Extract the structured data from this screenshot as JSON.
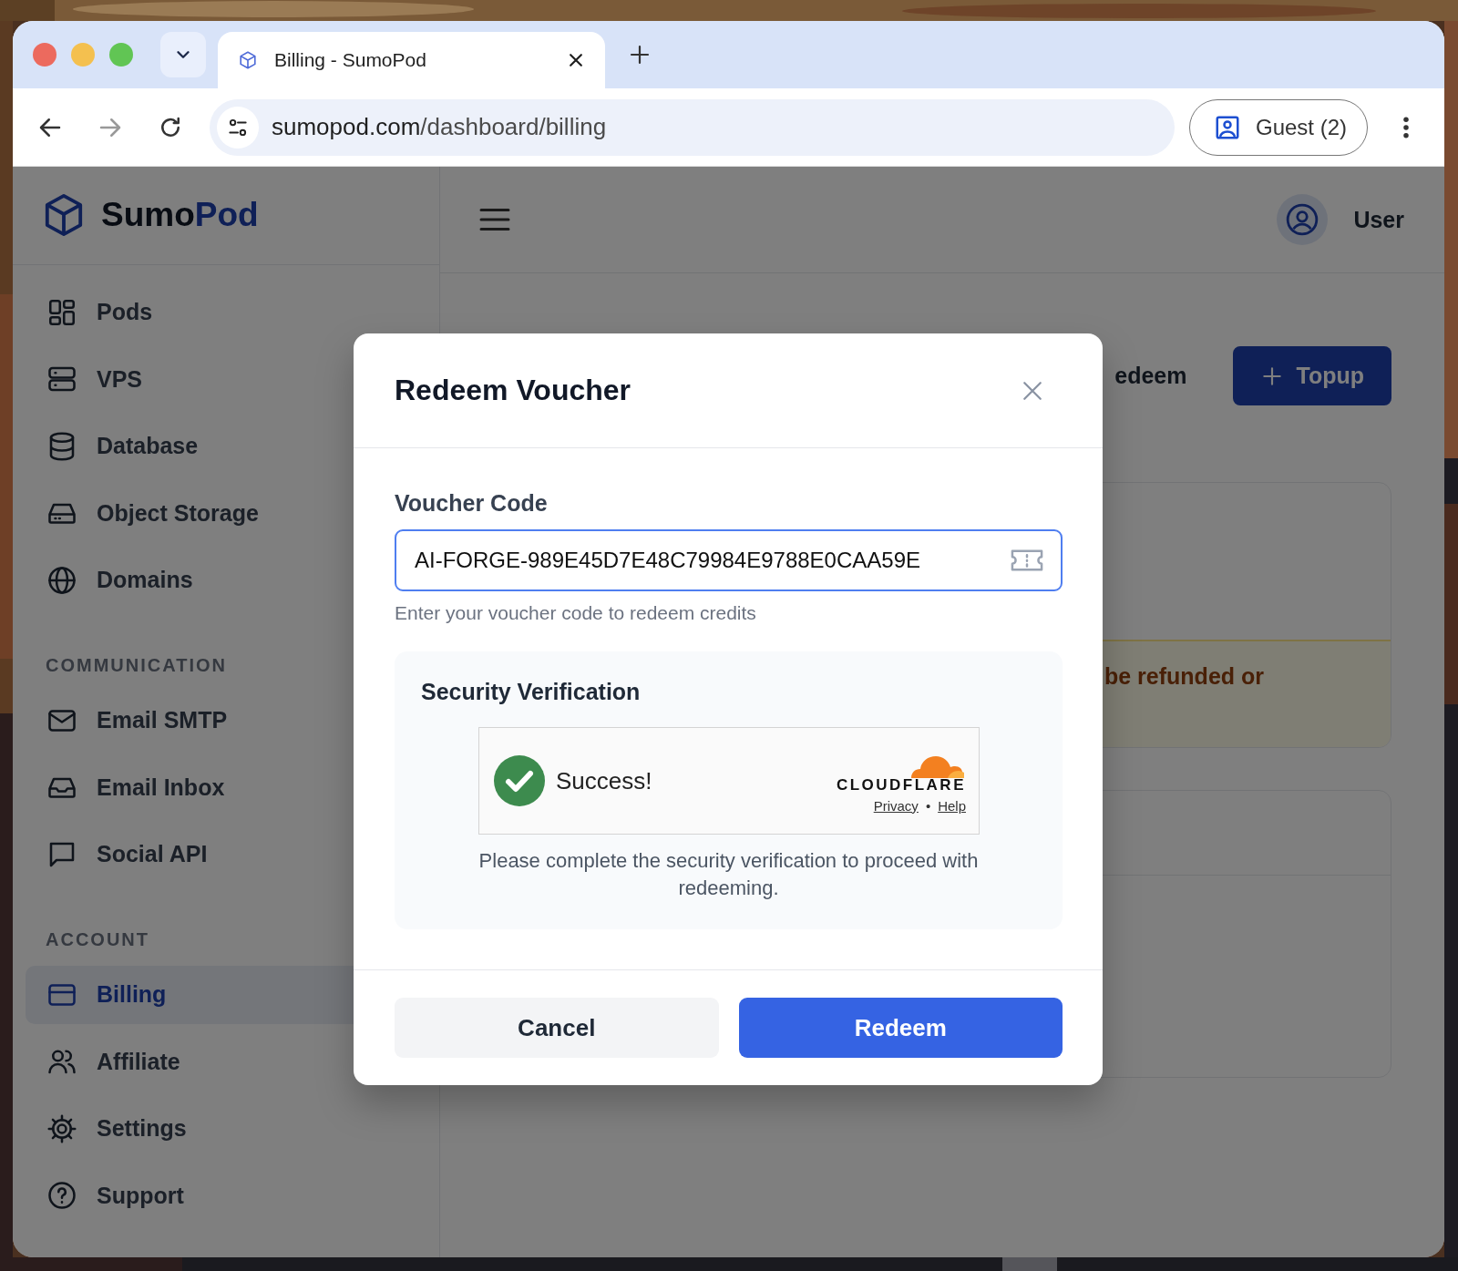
{
  "browser": {
    "tabs": [
      {
        "title": "Billing - SumoPod",
        "selected": true
      }
    ],
    "url": {
      "host": "sumopod.com",
      "path": "/dashboard/billing"
    },
    "profile": "Guest (2)"
  },
  "sidebar": {
    "brand": {
      "first": "Sumo",
      "second": "Pod"
    },
    "sections": [
      {
        "items": [
          {
            "label": "Pods",
            "selected": false
          },
          {
            "label": "VPS",
            "selected": false
          },
          {
            "label": "Database",
            "selected": false
          },
          {
            "label": "Object Storage",
            "selected": false
          },
          {
            "label": "Domains",
            "selected": false
          }
        ]
      },
      {
        "heading": "COMMUNICATION",
        "items": [
          {
            "label": "Email SMTP",
            "selected": false
          },
          {
            "label": "Email Inbox",
            "selected": false
          },
          {
            "label": "Social API",
            "selected": false
          }
        ]
      },
      {
        "heading": "ACCOUNT",
        "items": [
          {
            "label": "Billing",
            "selected": true
          },
          {
            "label": "Affiliate",
            "selected": false
          },
          {
            "label": "Settings",
            "selected": false
          },
          {
            "label": "Support",
            "selected": false
          }
        ]
      }
    ]
  },
  "header": {
    "user": "User"
  },
  "page": {
    "buttons": [
      {
        "label": "edeem",
        "kind": "plain"
      },
      {
        "label": "Topup",
        "kind": "primary"
      }
    ],
    "notice": "be refunded or"
  },
  "modal": {
    "title": "Redeem Voucher",
    "field": {
      "label": "Voucher Code",
      "value": "AI-FORGE-989E45D7E48C79984E9788E0CAA59E",
      "hint": "Enter your voucher code to redeem credits"
    },
    "verification": {
      "title": "Security Verification",
      "status": "Success!",
      "brand": "CLOUDFLARE",
      "links": [
        "Privacy",
        "Help"
      ],
      "separator": "•",
      "note": "Please complete the security verification to proceed with redeeming."
    },
    "buttons": [
      {
        "label": "Cancel",
        "kind": "secondary"
      },
      {
        "label": "Redeem",
        "kind": "primary"
      }
    ]
  }
}
